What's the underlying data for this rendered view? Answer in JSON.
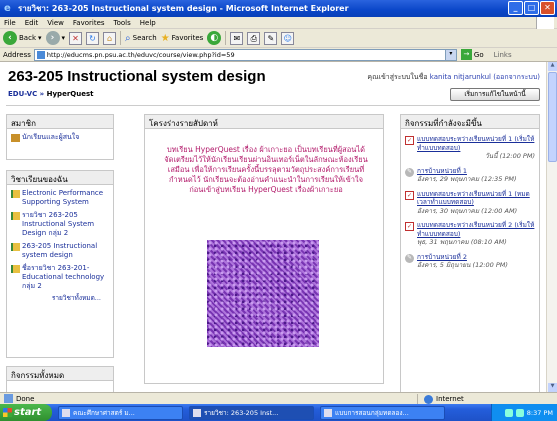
{
  "window": {
    "title": "รายวิชา: 263-205 Instructional system design - Microsoft Internet Explorer",
    "buttons": [
      "_",
      "□",
      "✕"
    ]
  },
  "menubar": [
    "File",
    "Edit",
    "View",
    "Favorites",
    "Tools",
    "Help"
  ],
  "toolbar": {
    "back": "Back",
    "search": "Search",
    "favorites": "Favorites"
  },
  "addressbar": {
    "label": "Address",
    "url": "http://educms.pn.psu.ac.th/eduvc/course/view.php?id=59",
    "go": "Go",
    "links": "Links"
  },
  "page": {
    "course_title": "263-205 Instructional system design",
    "login_prefix": "คุณเข้าสู่ระบบในชื่อ",
    "login_name": "kanita nitjarunkul",
    "login_suffix": "(ออกจากระบบ)",
    "breadcrumb": [
      "EDU-VC",
      "»",
      "HyperQuest"
    ],
    "edit_button": "เริ่มการแก้ไขในหน้านี้",
    "members": {
      "heading": "สมาชิก",
      "items": [
        "นักเรียนและผู้สนใจ"
      ]
    },
    "my_courses": {
      "heading": "วิชาเรียนของฉัน",
      "items": [
        "Electronic Performance Supporting System",
        "รายวิชา 263-205 Instructional System Design กลุ่ม 2",
        "263-205 Instructional system design",
        "ชื่อรายวิชา 263-201-Educational technology กลุ่ม 2"
      ],
      "all_link": "รายวิชาทั้งหมด..."
    },
    "all_activities": {
      "heading": "กิจกรรมทั้งหมด"
    },
    "weekly": {
      "heading": "โครงร่างรายสัปดาห์",
      "intro": "บทเรียน HyperQuest เรื่อง ผ้าเกาะยอ เป็นบทเรียนที่ผู้สอนได้จัดเตรียมไว้ให้นักเรียนเรียนผ่านอินเทอร์เน็ตในลักษณะห้องเรียนเสมือน เพื่อให้การเรียนครั้งนี้บรรลุตามวัตถุประสงค์การเรียนที่กำหนดไว้ นักเรียนจะต้องอ่านคำแนะนำในการเรียนให้เข้าใจก่อนเข้าสู่บทเรียน HyperQuest เรื่องผ้าเกาะยอ"
    },
    "upcoming": {
      "heading": "กิจกรรมที่กำลังจะมีขึ้น",
      "events": [
        {
          "type": "quiz",
          "title": "แบบทดสอบระหว่างเรียนหน่วยที่ 1 (เริ่มให้ทำแบบทดสอบ)",
          "date": "วันนี้ (12:00 PM)"
        },
        {
          "type": "assignment",
          "title": "การบ้านหน่วยที่ 1",
          "date": "อังคาร, 29 พฤษภาคม (12:35 PM)"
        },
        {
          "type": "quiz",
          "title": "แบบทดสอบระหว่างเรียนหน่วยที่ 1 (หมดเวลาทำแบบทดสอบ)",
          "date": "อังคาร, 30 พฤษภาคม (12:00 AM)"
        },
        {
          "type": "quiz",
          "title": "แบบทดสอบระหว่างเรียนหน่วยที่ 2 (เริ่มให้ทำแบบทดสอบ)",
          "date": "พุธ, 31 พฤษภาคม (08:10 AM)"
        },
        {
          "type": "assignment",
          "title": "การบ้านหน่วยที่ 2",
          "date": "อังคาร, 5 มิถุนายน (12:00 PM)"
        }
      ]
    }
  },
  "statusbar": {
    "text": "Done",
    "zone": "Internet"
  },
  "taskbar": {
    "start": "start",
    "tasks": [
      "คณะศึกษาศาสตร์ ม...",
      "รายวิชา: 263-205 Inst...",
      "แบบการสอนกลุ่มทดลอง..."
    ],
    "clock": "8:37 PM"
  },
  "colors": {
    "title_bar": "#0a46c8",
    "intro_text": "#b21a6a",
    "link": "#1a2f9a",
    "texture": "#8e46c8"
  }
}
